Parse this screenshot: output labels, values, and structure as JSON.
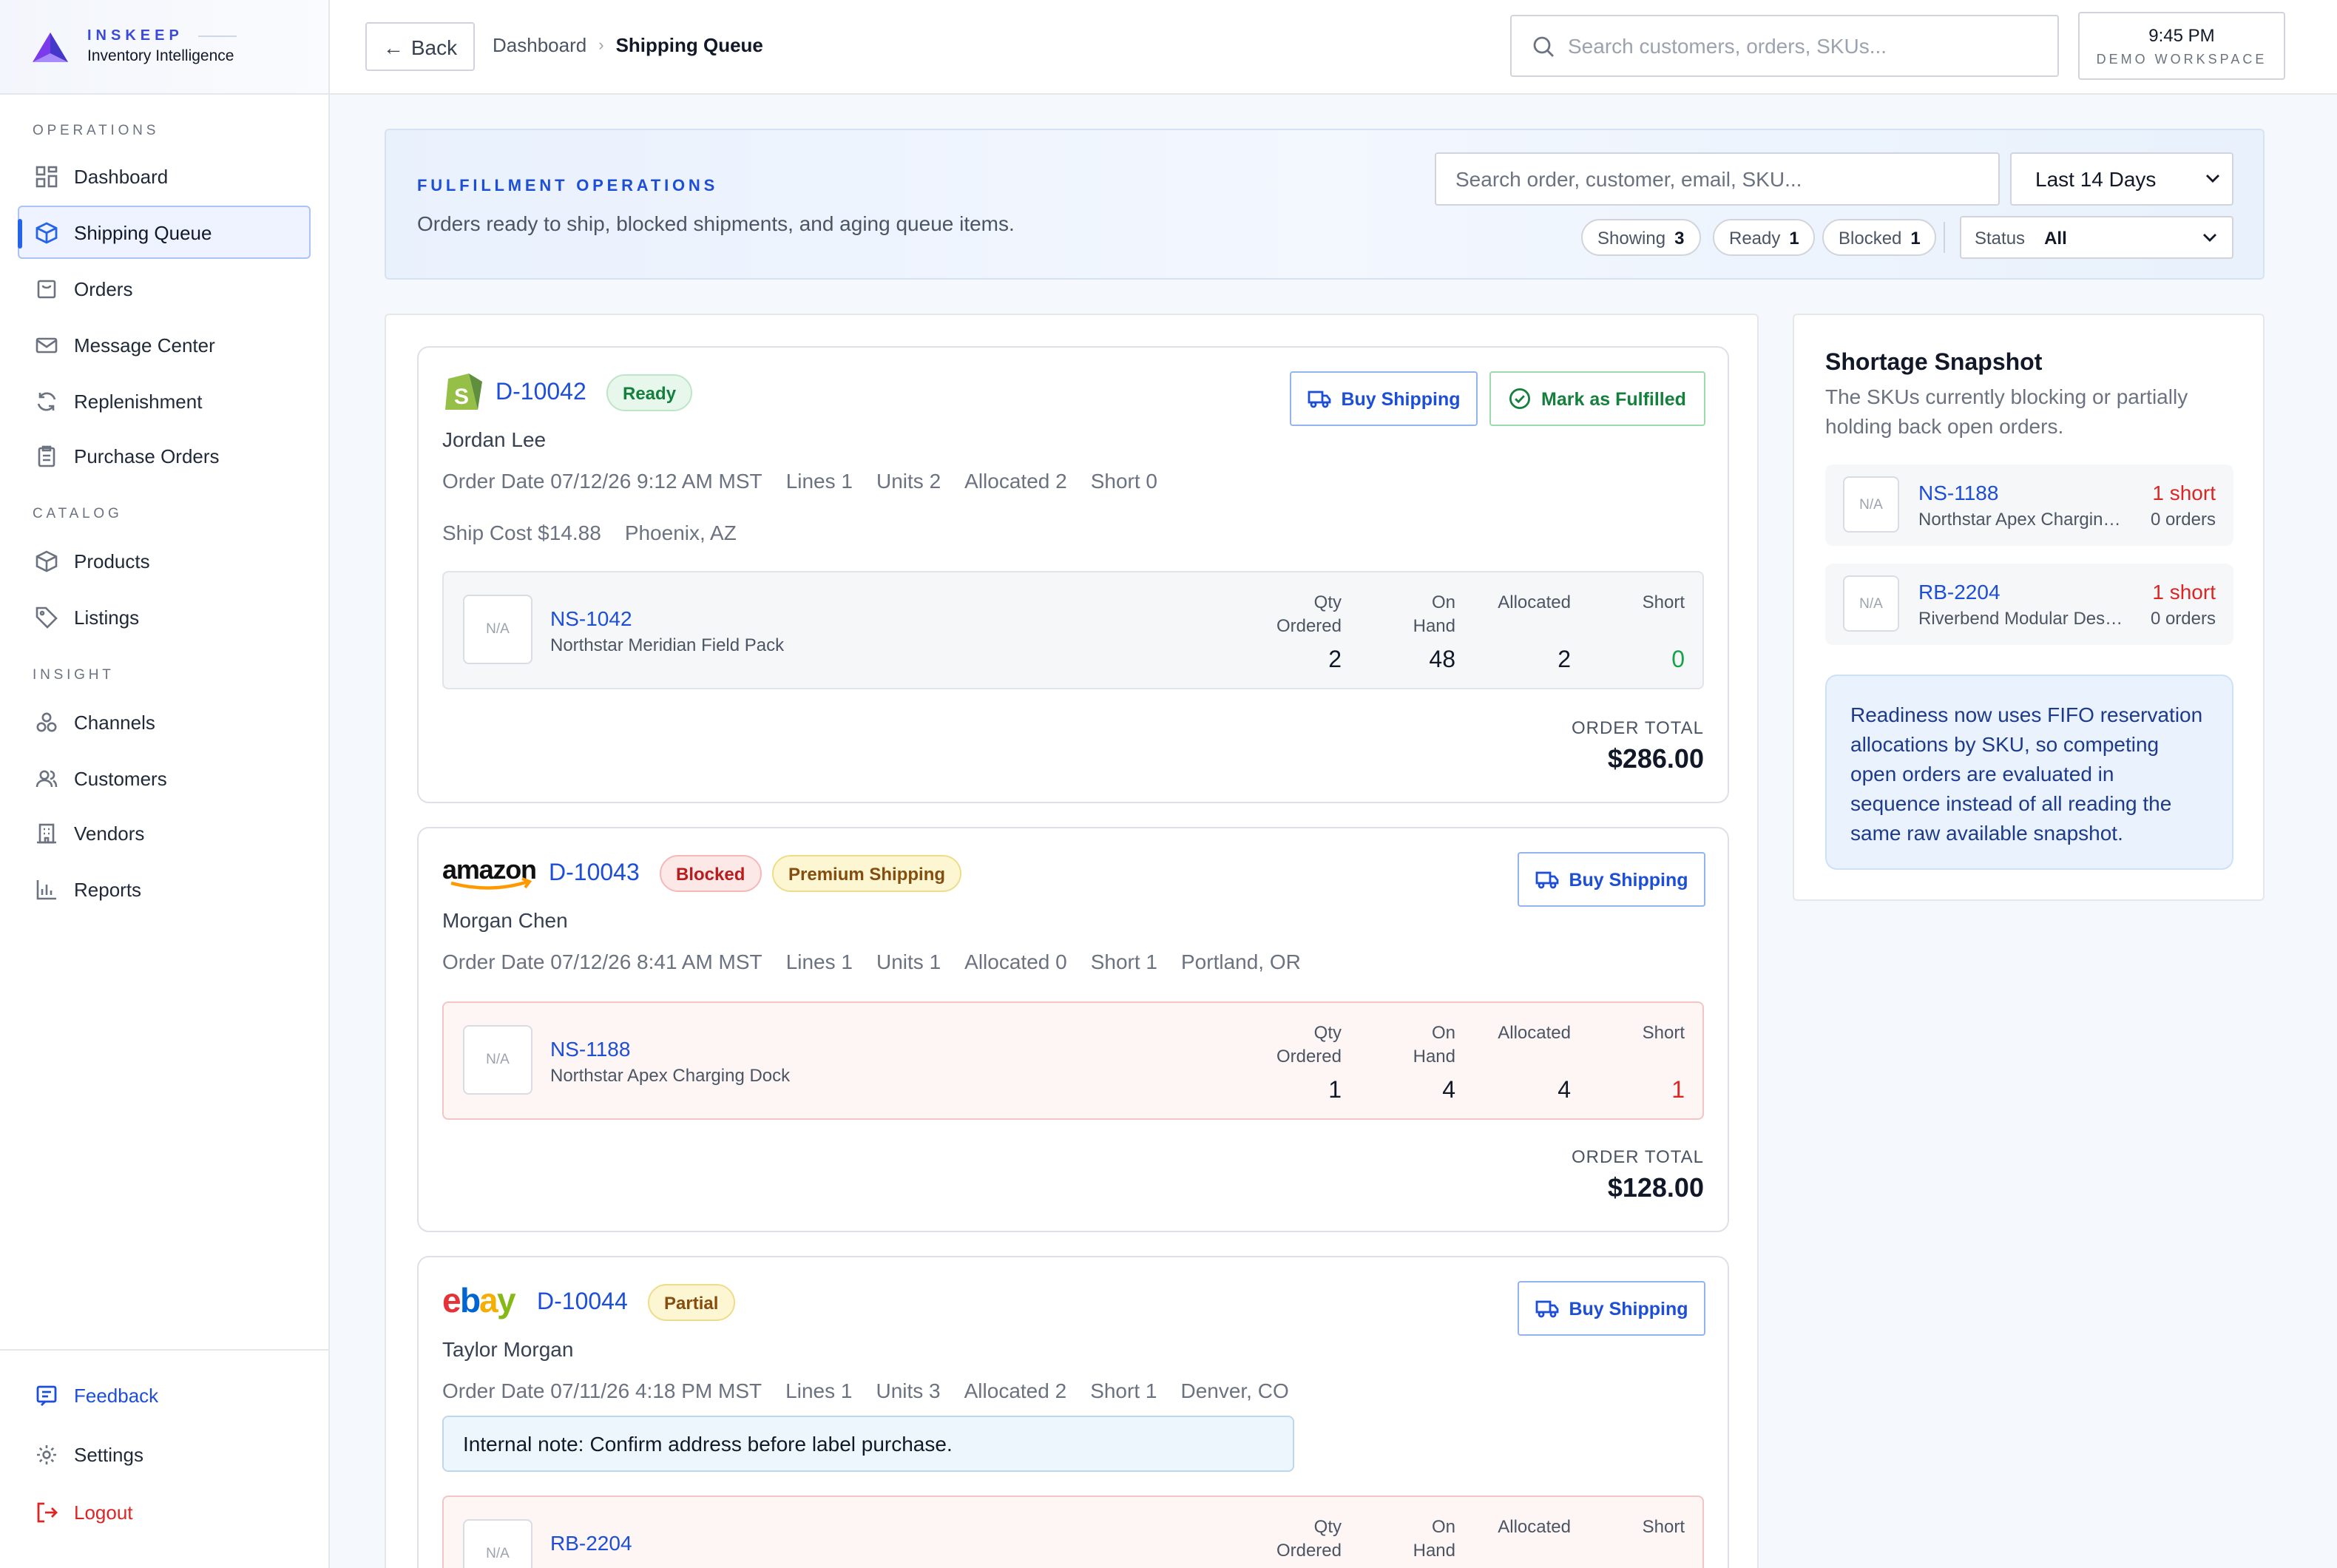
{
  "brand": {
    "name": "INSKEEP",
    "sub": "Inventory Intelligence"
  },
  "sidebar": {
    "sections": [
      "OPERATIONS",
      "CATALOG",
      "INSIGHT"
    ],
    "items": [
      {
        "label": "Dashboard",
        "icon": "grid-icon"
      },
      {
        "label": "Shipping Queue",
        "icon": "box-icon",
        "active": true
      },
      {
        "label": "Orders",
        "icon": "bag-icon"
      },
      {
        "label": "Message Center",
        "icon": "mail-icon"
      },
      {
        "label": "Replenishment",
        "icon": "refresh-icon"
      },
      {
        "label": "Purchase Orders",
        "icon": "clipboard-icon"
      },
      {
        "label": "Products",
        "icon": "cube-icon"
      },
      {
        "label": "Listings",
        "icon": "tag-icon"
      },
      {
        "label": "Channels",
        "icon": "channels-icon"
      },
      {
        "label": "Customers",
        "icon": "users-icon"
      },
      {
        "label": "Vendors",
        "icon": "building-icon"
      },
      {
        "label": "Reports",
        "icon": "bar-chart-icon"
      }
    ],
    "bottom": [
      {
        "label": "Feedback",
        "icon": "feedback-icon",
        "color": "#1d4ed8"
      },
      {
        "label": "Settings",
        "icon": "gear-icon"
      },
      {
        "label": "Logout",
        "icon": "logout-icon",
        "color": "#dc2626"
      }
    ]
  },
  "topbar": {
    "back": "Back",
    "breadcrumb": [
      "Dashboard",
      "Shipping Queue"
    ],
    "search_placeholder": "Search customers, orders, SKUs...",
    "time": "9:45 PM",
    "workspace": "DEMO WORKSPACE"
  },
  "hero": {
    "eyebrow": "FULFILLMENT OPERATIONS",
    "description": "Orders ready to ship, blocked shipments, and aging queue items.",
    "search_placeholder": "Search order, customer, email, SKU...",
    "range": "Last 14 Days",
    "pills": [
      {
        "label": "Showing",
        "value": "3"
      },
      {
        "label": "Ready",
        "value": "1"
      },
      {
        "label": "Blocked",
        "value": "1"
      }
    ],
    "status_label": "Status",
    "status_value": "All"
  },
  "columns": {
    "qty": [
      "Qty",
      "Ordered"
    ],
    "onhand": [
      "On",
      "Hand"
    ],
    "allocated": "Allocated",
    "short": "Short"
  },
  "orders": [
    {
      "channel": "shopify-logo",
      "id": "D-10042",
      "badges": [
        "Ready"
      ],
      "actions": [
        "Buy Shipping",
        "Mark as Fulfilled"
      ],
      "customer": "Jordan Lee",
      "meta": [
        "Order Date 07/12/26 9:12 AM MST",
        "Lines 1",
        "Units 2",
        "Allocated 2",
        "Short 0"
      ],
      "meta2": [
        "Ship Cost $14.88",
        "Phoenix, AZ"
      ],
      "line": {
        "thumb": "N/A",
        "sku": "NS-1042",
        "name": "Northstar Meridian Field Pack",
        "qty": "2",
        "onhand": "48",
        "allocated": "2",
        "short": "0"
      },
      "total_label": "ORDER TOTAL",
      "total": "$286.00"
    },
    {
      "channel": "amazon-logo",
      "id": "D-10043",
      "badges": [
        "Blocked",
        "Premium Shipping"
      ],
      "actions": [
        "Buy Shipping"
      ],
      "customer": "Morgan Chen",
      "meta": [
        "Order Date 07/12/26 8:41 AM MST",
        "Lines 1",
        "Units 1",
        "Allocated 0",
        "Short 1",
        "Portland, OR"
      ],
      "line": {
        "thumb": "N/A",
        "sku": "NS-1188",
        "name": "Northstar Apex Charging Dock",
        "qty": "1",
        "onhand": "4",
        "allocated": "4",
        "short": "1"
      },
      "total_label": "ORDER TOTAL",
      "total": "$128.00"
    },
    {
      "channel": "ebay-logo",
      "id": "D-10044",
      "badges": [
        "Partial"
      ],
      "actions": [
        "Buy Shipping"
      ],
      "customer": "Taylor Morgan",
      "meta": [
        "Order Date 07/11/26 4:18 PM MST",
        "Lines 1",
        "Units 3",
        "Allocated 2",
        "Short 1",
        "Denver, CO"
      ],
      "note_label": "Internal note:",
      "note": "Confirm address before label purchase.",
      "line": {
        "thumb": "N/A",
        "sku": "RB-2204"
      }
    }
  ],
  "logos": {
    "amazon": "amazon",
    "ebay": [
      "e",
      "b",
      "a",
      "y"
    ]
  },
  "shortage": {
    "title": "Shortage Snapshot",
    "description": "The SKUs currently blocking or partially holding back open orders.",
    "items": [
      {
        "thumb": "N/A",
        "sku": "NS-1188",
        "name": "Northstar Apex Charging Dock",
        "short": "1 short",
        "orders": "0 orders"
      },
      {
        "thumb": "N/A",
        "sku": "RB-2204",
        "name": "Riverbend Modular Desk Organizer",
        "short": "1 short",
        "orders": "0 orders"
      }
    ],
    "info": "Readiness now uses FIFO reservation allocations by SKU, so competing open orders are evaluated in sequence instead of all reading the same raw available snapshot."
  }
}
